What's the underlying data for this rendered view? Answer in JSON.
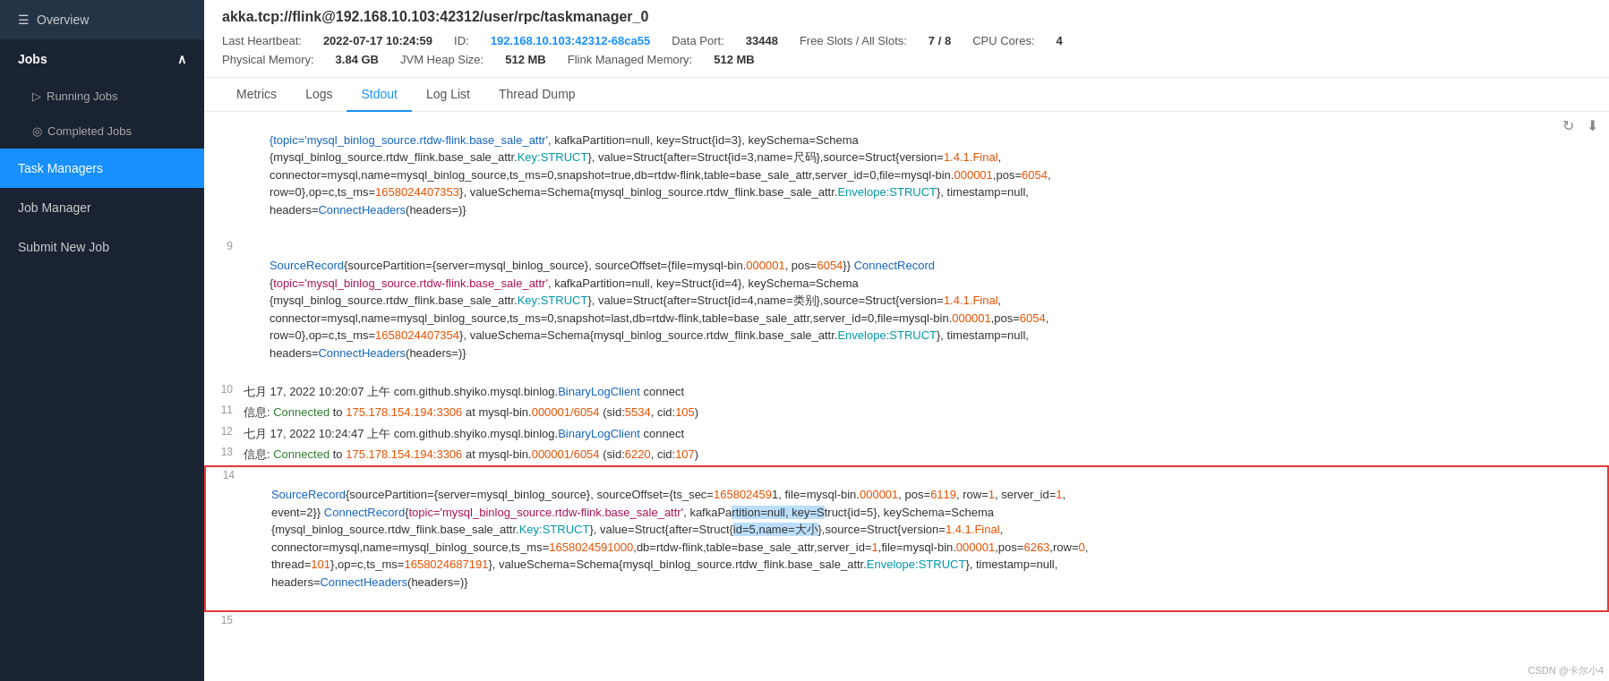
{
  "sidebar": {
    "items": [
      {
        "id": "overview",
        "label": "Overview",
        "icon": "≡",
        "active": false,
        "type": "top"
      },
      {
        "id": "jobs",
        "label": "Jobs",
        "icon": "",
        "active": false,
        "type": "section"
      },
      {
        "id": "running-jobs",
        "label": "Running Jobs",
        "icon": "▷",
        "active": false,
        "type": "sub"
      },
      {
        "id": "completed-jobs",
        "label": "Completed Jobs",
        "icon": "◎",
        "active": false,
        "type": "sub"
      },
      {
        "id": "task-managers",
        "label": "Task Managers",
        "icon": "",
        "active": true,
        "type": "top"
      },
      {
        "id": "job-manager",
        "label": "Job Manager",
        "icon": "",
        "active": false,
        "type": "top"
      },
      {
        "id": "submit-new-job",
        "label": "Submit New Job",
        "icon": "",
        "active": false,
        "type": "top"
      }
    ]
  },
  "header": {
    "title": "akka.tcp://flink@192.168.10.103:42312/user/rpc/taskmanager_0",
    "last_heartbeat_label": "Last Heartbeat:",
    "last_heartbeat_value": "2022-07-17 10:24:59",
    "id_label": "ID:",
    "id_value": "192.168.10.103:42312-68ca55",
    "data_port_label": "Data Port:",
    "data_port_value": "33448",
    "free_slots_label": "Free Slots / All Slots:",
    "free_slots_value": "7 / 8",
    "cpu_cores_label": "CPU Cores:",
    "cpu_cores_value": "4",
    "physical_memory_label": "Physical Memory:",
    "physical_memory_value": "3.84 GB",
    "jvm_heap_label": "JVM Heap Size:",
    "jvm_heap_value": "512 MB",
    "flink_managed_label": "Flink Managed Memory:",
    "flink_managed_value": "512 MB"
  },
  "tabs": [
    {
      "id": "metrics",
      "label": "Metrics",
      "active": false
    },
    {
      "id": "logs",
      "label": "Logs",
      "active": false
    },
    {
      "id": "stdout",
      "label": "Stdout",
      "active": true
    },
    {
      "id": "log-list",
      "label": "Log List",
      "active": false
    },
    {
      "id": "thread-dump",
      "label": "Thread Dump",
      "active": false
    }
  ],
  "watermark": "CSDN @卡尔小4"
}
